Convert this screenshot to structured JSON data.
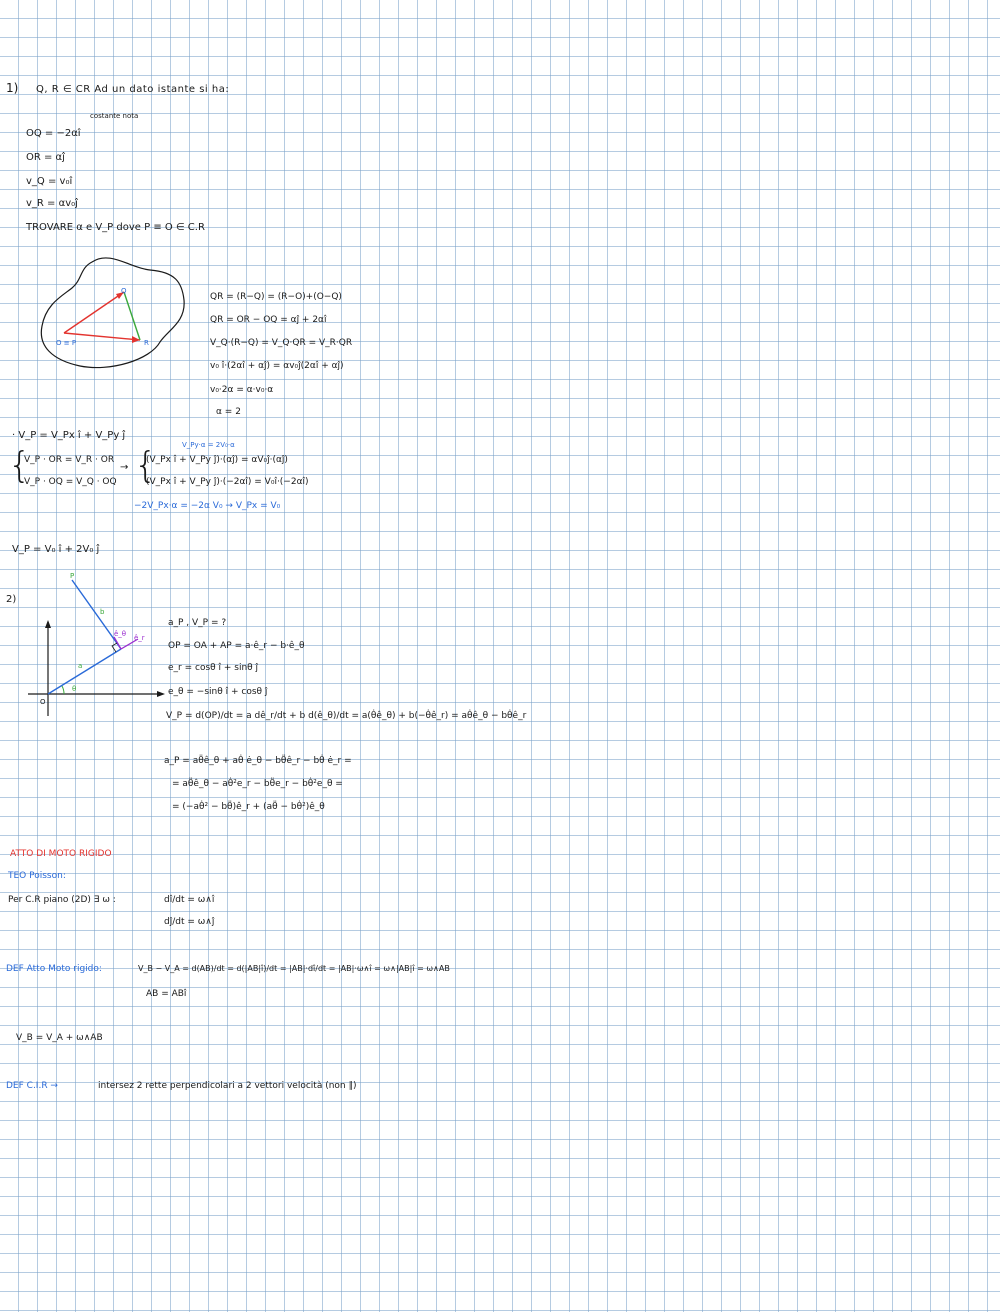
{
  "ex1": {
    "number": "1)",
    "header": "Q, R ∈ CR  Ad un dato istante si ha:",
    "note": "costante nota",
    "givens": [
      "OQ = −2αî",
      "OR = αĵ",
      "v_Q = v₀î",
      "v_R = αv₀ĵ"
    ],
    "find": "TROVARE  α  e  V_P  dove  P ≡ O ∈ C.R",
    "fig_labels": {
      "q": "Q",
      "r": "R",
      "op": "O ≡ P"
    },
    "calc": [
      "QR = (R−Q) = (R−O)+(O−Q)",
      "QR = OR − OQ = αĵ + 2αî",
      "V_Q·(R−Q) = V_Q·QR = V_R·QR",
      "v₀ î·(2αî + αĵ) = αv₀ĵ(2αî + αĵ)",
      "v₀·2α = α·v₀·α",
      "α = 2"
    ],
    "vp_def": "· V_P = V_Px î + V_Py ĵ",
    "blue_note": "V_Py·α = 2V₀·α",
    "sys": [
      "V_P · OR = V_R · OR",
      "V_P · OQ = V_Q · OQ"
    ],
    "sys_rhs": [
      "(V_Px î + V_Py ĵ)·(αĵ) = αV₀ĵ·(αĵ)",
      "(V_Px î + V_Py ĵ)·(−2αî) = V₀î·(−2αî)"
    ],
    "blue_result": "−2V_Px·α = −2α V₀ → V_Px = V₀",
    "final": "V_P = V₀ î + 2V₀ ĵ"
  },
  "ex2": {
    "number": "2)",
    "fig_labels": {
      "p": "P",
      "b": "b",
      "a": "a",
      "o": "O",
      "theta": "θ",
      "er": "ê_r",
      "eth": "ê_θ"
    },
    "lines": [
      "a_P , V_P = ?",
      "OP = OA + AP = a·ê_r − b·ê_θ",
      "e_r = cosθ î + sinθ ĵ",
      "e_θ = −sinθ î + cosθ ĵ",
      "V_P = d(OP)/dt = a dê_r/dt + b d(ê_θ)/dt = a(θ̇ê_θ) + b(−θ̇ê_r) = aθ̇ê_θ − bθ̇ê_r",
      "a_P = aθ̈ê_θ + aθ̇ ė_θ − bθ̈ê_r − bθ̇ ė_r =",
      "= aθ̈ê_θ − aθ̇²e_r − bθ̈e_r − bθ̇²e_θ =",
      "= (−aθ̇² − bθ̈)ê_r + (aθ̈ − bθ̇²)ê_θ"
    ]
  },
  "rigid": {
    "title": "ATTO DI MOTO RIGIDO",
    "teo": "TEO Poisson:",
    "poisson_intro": "Per C.R piano (2D) ∃ ω :",
    "poisson": [
      "dî/dt = ω∧î",
      "dĵ/dt = ω∧ĵ"
    ],
    "def_label": "DEF Atto Moto rigido:",
    "def_eq": "V_B − V_A = d(AB)/dt = d(|AB|î)/dt = |AB|·dî/dt = |AB|·ω∧î = ω∧|AB|î = ω∧AB",
    "ab_eq": "AB = ABî",
    "boxed": "V_B = V_A + ω∧AB",
    "cir_label": "DEF  C.I.R →",
    "cir_text": "intersez 2 rette perpendicolari a 2 vettori velocità (non ∥)"
  },
  "colors": {
    "ink": "#1a1a1a",
    "blue": "#2a6ad8",
    "red": "#e3342f",
    "green": "#3aa83a",
    "purple": "#9a2ccf",
    "grid": "#78a0c8"
  }
}
